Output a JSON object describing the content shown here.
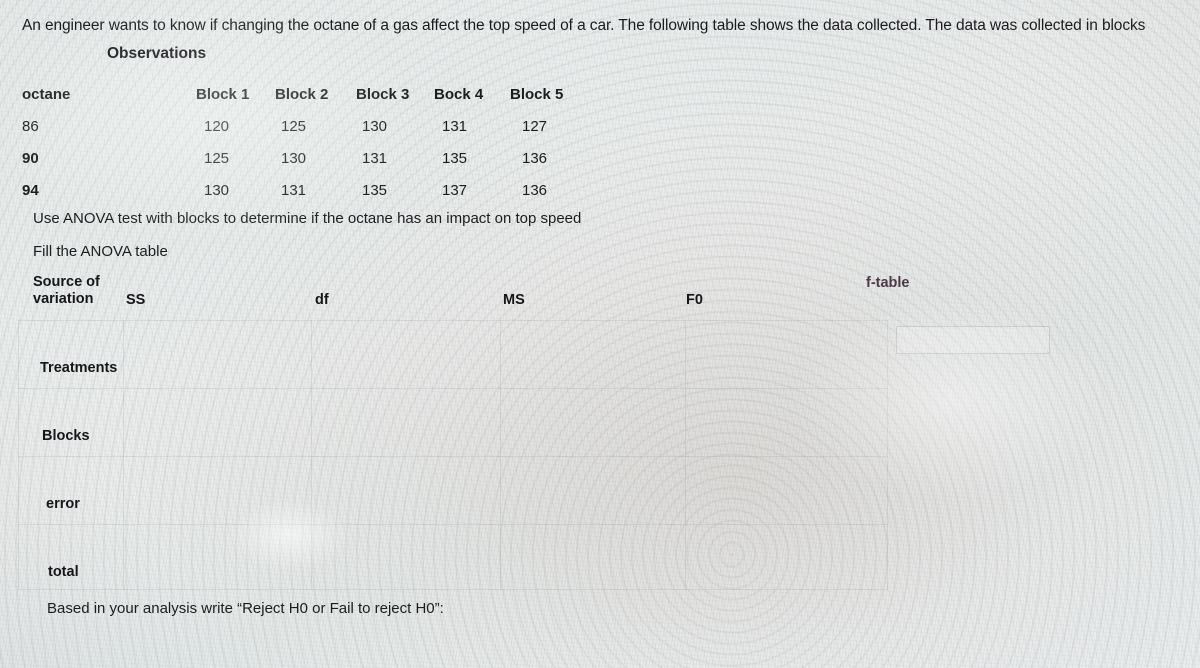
{
  "problem": {
    "prompt": "An engineer wants to know if changing the octane of a gas affect the top speed of a car. The following table shows the data collected. The data was collected in blocks",
    "observations_label": "Observations",
    "instruction_use": "Use  ANOVA test with blocks to determine if the octane has an impact on top speed",
    "instruction_fill": "Fill the ANOVA table",
    "instruction_conclusion": "Based in your analysis write “Reject H0 or Fail to reject H0”:"
  },
  "observations_table": {
    "columns": [
      "octane",
      "Block 1",
      "Block 2",
      "Block 3",
      "Bock 4",
      "Block 5"
    ],
    "rows": [
      {
        "octane": "86",
        "values": [
          "120",
          "125",
          "130",
          "131",
          "127"
        ]
      },
      {
        "octane": "90",
        "values": [
          "125",
          "130",
          "131",
          "135",
          "136"
        ]
      },
      {
        "octane": "94",
        "values": [
          "130",
          "131",
          "135",
          "137",
          "136"
        ]
      }
    ]
  },
  "anova_table": {
    "headers": {
      "source_line1": "Source of",
      "source_line2": "variation",
      "ss": "SS",
      "df": "df",
      "ms": "MS",
      "f0": "F0"
    },
    "row_labels": [
      "Treatments",
      "Blocks",
      "error",
      "total"
    ],
    "ftable_label": "f-table",
    "ftable_value": ""
  },
  "colors": {
    "text": "#1d1d20",
    "heading": "#16161a",
    "ftable_accent": "#4b3a48",
    "grid_line": "rgba(120,135,145,0.16)",
    "background": "#e9eeec"
  }
}
